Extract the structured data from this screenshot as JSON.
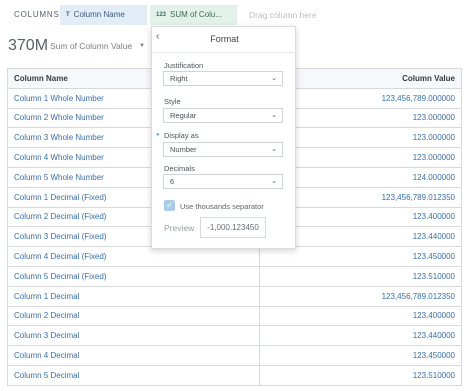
{
  "topbar": {
    "columns_label": "COLUMNS",
    "pill_column": {
      "type_icon": "T",
      "label": "Column Name"
    },
    "pill_sum": {
      "type_icon": "123",
      "label": "SUM of Colu..."
    },
    "drag_hint": "Drag column here"
  },
  "summary": {
    "total": "370M",
    "label": "Sum of Column Value"
  },
  "table": {
    "headers": {
      "name": "Column Name",
      "value": "Column Value"
    },
    "rows": [
      {
        "name": "Column 1 Whole Number",
        "value": "123,456,789.000000"
      },
      {
        "name": "Column 2 Whole Number",
        "value": "123.000000"
      },
      {
        "name": "Column 3 Whole Number",
        "value": "123.000000"
      },
      {
        "name": "Column 4 Whole Number",
        "value": "123.000000"
      },
      {
        "name": "Column 5 Whole Number",
        "value": "124.000000"
      },
      {
        "name": "Column 1 Decimal (Fixed)",
        "value": "123,456,789.012350"
      },
      {
        "name": "Column 2 Decimal (Fixed)",
        "value": "123.400000"
      },
      {
        "name": "Column 3 Decimal (Fixed)",
        "value": "123.440000"
      },
      {
        "name": "Column 4 Decimal (Fixed)",
        "value": "123.450000"
      },
      {
        "name": "Column 5 Decimal (Fixed)",
        "value": "123.510000"
      },
      {
        "name": "Column 1 Decimal",
        "value": "123,456,789.012350"
      },
      {
        "name": "Column 2 Decimal",
        "value": "123.400000"
      },
      {
        "name": "Column 3 Decimal",
        "value": "123.440000"
      },
      {
        "name": "Column 4 Decimal",
        "value": "123.450000"
      },
      {
        "name": "Column 5 Decimal",
        "value": "123.510000"
      }
    ]
  },
  "format_popover": {
    "title": "Format",
    "justification": {
      "label": "Justification",
      "value": "Right"
    },
    "style": {
      "label": "Style",
      "value": "Regular"
    },
    "display_as": {
      "label": "Display as",
      "value": "Number"
    },
    "decimals": {
      "label": "Decimals",
      "value": "6"
    },
    "thousands_separator": {
      "label": "Use thousands separator",
      "checked": true
    },
    "preview": {
      "label": "Preview",
      "value": "-1,000.123450"
    }
  },
  "colors": {
    "link_blue": "#3b6fa6",
    "pill_column_bg": "#e3edf7",
    "pill_sum_bg": "#e2f2ea",
    "checkbox_blue": "#a9cdea"
  },
  "icons": [
    "back-chevron-icon",
    "chevron-down-icon",
    "checkmark-icon",
    "text-type-icon",
    "number-type-icon"
  ]
}
